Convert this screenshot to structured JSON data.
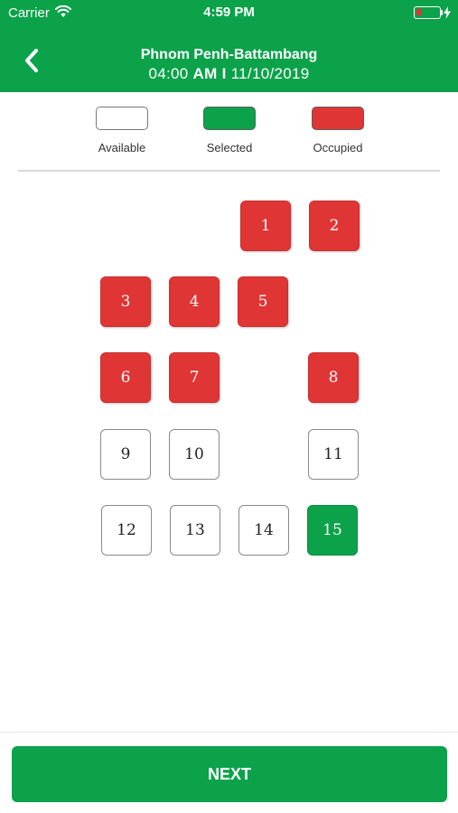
{
  "status_bar": {
    "carrier": "Carrier",
    "time": "4:59 PM"
  },
  "header": {
    "title": "Phnom Penh-Battambang",
    "time": "04:00",
    "ampm": "AM",
    "separator": "I",
    "date": "11/10/2019"
  },
  "legend": {
    "available": "Available",
    "selected": "Selected",
    "occupied": "Occupied"
  },
  "colors": {
    "brand_green": "#0ba24a",
    "occupied_red": "#e03535",
    "available_white": "#ffffff"
  },
  "seats": [
    {
      "number": "1",
      "status": "occupied"
    },
    {
      "number": "2",
      "status": "occupied"
    },
    {
      "number": "3",
      "status": "occupied"
    },
    {
      "number": "4",
      "status": "occupied"
    },
    {
      "number": "5",
      "status": "occupied"
    },
    {
      "number": "6",
      "status": "occupied"
    },
    {
      "number": "7",
      "status": "occupied"
    },
    {
      "number": "8",
      "status": "occupied"
    },
    {
      "number": "9",
      "status": "available"
    },
    {
      "number": "10",
      "status": "available"
    },
    {
      "number": "11",
      "status": "available"
    },
    {
      "number": "12",
      "status": "available"
    },
    {
      "number": "13",
      "status": "available"
    },
    {
      "number": "14",
      "status": "available"
    },
    {
      "number": "15",
      "status": "selected"
    }
  ],
  "footer": {
    "next_label": "NEXT"
  }
}
